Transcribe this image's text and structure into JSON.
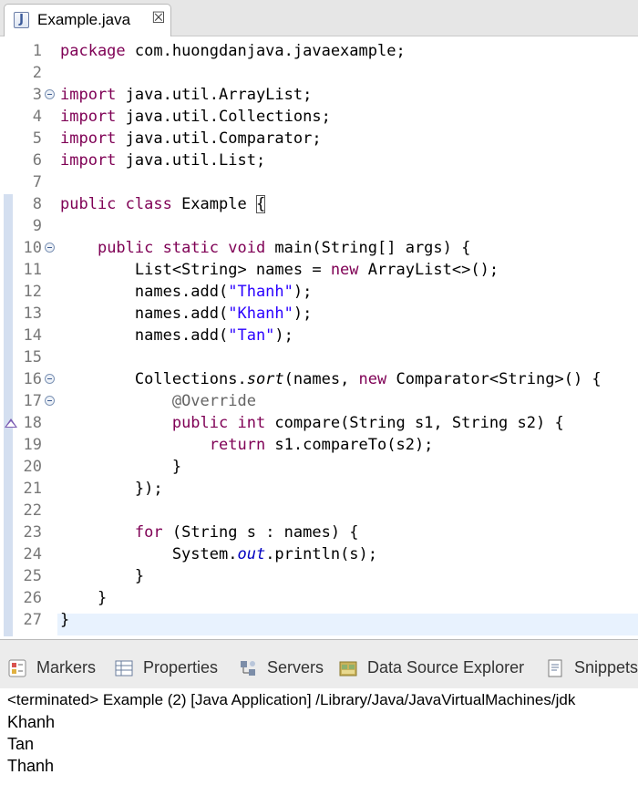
{
  "editor_tab": {
    "icon_letter": "J",
    "title": "Example.java",
    "close_glyph": "☒"
  },
  "lines": [
    {
      "n": "1",
      "parts": [
        {
          "t": "package",
          "c": "kw"
        },
        {
          "t": " com.huongdanjava.javaexample;"
        }
      ]
    },
    {
      "n": "2",
      "parts": []
    },
    {
      "n": "3",
      "fold": true,
      "parts": [
        {
          "t": "import",
          "c": "kw"
        },
        {
          "t": " java.util.ArrayList;"
        }
      ]
    },
    {
      "n": "4",
      "parts": [
        {
          "t": "import",
          "c": "kw"
        },
        {
          "t": " java.util.Collections;"
        }
      ]
    },
    {
      "n": "5",
      "parts": [
        {
          "t": "import",
          "c": "kw"
        },
        {
          "t": " java.util.Comparator;"
        }
      ]
    },
    {
      "n": "6",
      "parts": [
        {
          "t": "import",
          "c": "kw"
        },
        {
          "t": " java.util.List;"
        }
      ]
    },
    {
      "n": "7",
      "parts": []
    },
    {
      "n": "8",
      "parts": [
        {
          "t": "public class",
          "c": "kw"
        },
        {
          "t": " Example "
        },
        {
          "t": "{",
          "c": "bracket"
        }
      ]
    },
    {
      "n": "9",
      "parts": []
    },
    {
      "n": "10",
      "fold": true,
      "parts": [
        {
          "t": "    "
        },
        {
          "t": "public static void",
          "c": "kw"
        },
        {
          "t": " main(String[] args) {"
        }
      ]
    },
    {
      "n": "11",
      "parts": [
        {
          "t": "        List<String> names = "
        },
        {
          "t": "new",
          "c": "kw"
        },
        {
          "t": " ArrayList<>();"
        }
      ]
    },
    {
      "n": "12",
      "parts": [
        {
          "t": "        names.add("
        },
        {
          "t": "\"Thanh\"",
          "c": "str"
        },
        {
          "t": ");"
        }
      ]
    },
    {
      "n": "13",
      "parts": [
        {
          "t": "        names.add("
        },
        {
          "t": "\"Khanh\"",
          "c": "str"
        },
        {
          "t": ");"
        }
      ]
    },
    {
      "n": "14",
      "parts": [
        {
          "t": "        names.add("
        },
        {
          "t": "\"Tan\"",
          "c": "str"
        },
        {
          "t": ");"
        }
      ]
    },
    {
      "n": "15",
      "parts": []
    },
    {
      "n": "16",
      "fold": true,
      "parts": [
        {
          "t": "        Collections."
        },
        {
          "t": "sort",
          "c": "ital"
        },
        {
          "t": "(names, "
        },
        {
          "t": "new",
          "c": "kw"
        },
        {
          "t": " Comparator<String>() {"
        }
      ]
    },
    {
      "n": "17",
      "fold": true,
      "parts": [
        {
          "t": "            "
        },
        {
          "t": "@Override",
          "c": "ann"
        }
      ]
    },
    {
      "n": "18",
      "override": true,
      "parts": [
        {
          "t": "            "
        },
        {
          "t": "public int",
          "c": "kw"
        },
        {
          "t": " compare(String s1, String s2) {"
        }
      ]
    },
    {
      "n": "19",
      "parts": [
        {
          "t": "                "
        },
        {
          "t": "return",
          "c": "kw"
        },
        {
          "t": " s1.compareTo(s2);"
        }
      ]
    },
    {
      "n": "20",
      "parts": [
        {
          "t": "            }"
        }
      ]
    },
    {
      "n": "21",
      "parts": [
        {
          "t": "        });"
        }
      ]
    },
    {
      "n": "22",
      "parts": []
    },
    {
      "n": "23",
      "parts": [
        {
          "t": "        "
        },
        {
          "t": "for",
          "c": "kw"
        },
        {
          "t": " (String s : names) {"
        }
      ]
    },
    {
      "n": "24",
      "parts": [
        {
          "t": "            System."
        },
        {
          "t": "out",
          "c": "fld"
        },
        {
          "t": ".println(s);"
        }
      ]
    },
    {
      "n": "25",
      "parts": [
        {
          "t": "        }"
        }
      ]
    },
    {
      "n": "26",
      "parts": [
        {
          "t": "    }"
        }
      ]
    },
    {
      "n": "27",
      "parts": [
        {
          "t": "}"
        }
      ]
    }
  ],
  "views_tabs": [
    {
      "label": "Markers",
      "icon": "markers-icon"
    },
    {
      "label": "Properties",
      "icon": "properties-icon"
    },
    {
      "label": "Servers",
      "icon": "servers-icon"
    },
    {
      "label": "Data Source Explorer",
      "icon": "data-source-explorer-icon"
    },
    {
      "label": "Snippets",
      "icon": "snippets-icon"
    }
  ],
  "console": {
    "header": "<terminated> Example (2) [Java Application] /Library/Java/JavaVirtualMachines/jdk",
    "output": [
      "Khanh",
      "Tan",
      "Thanh"
    ]
  },
  "colors": {
    "keyword": "#7f0055",
    "string": "#2a00ff",
    "field": "#0000c0",
    "annotation": "#646464",
    "line_number": "#787878",
    "current_line": "#e8f2fe"
  }
}
